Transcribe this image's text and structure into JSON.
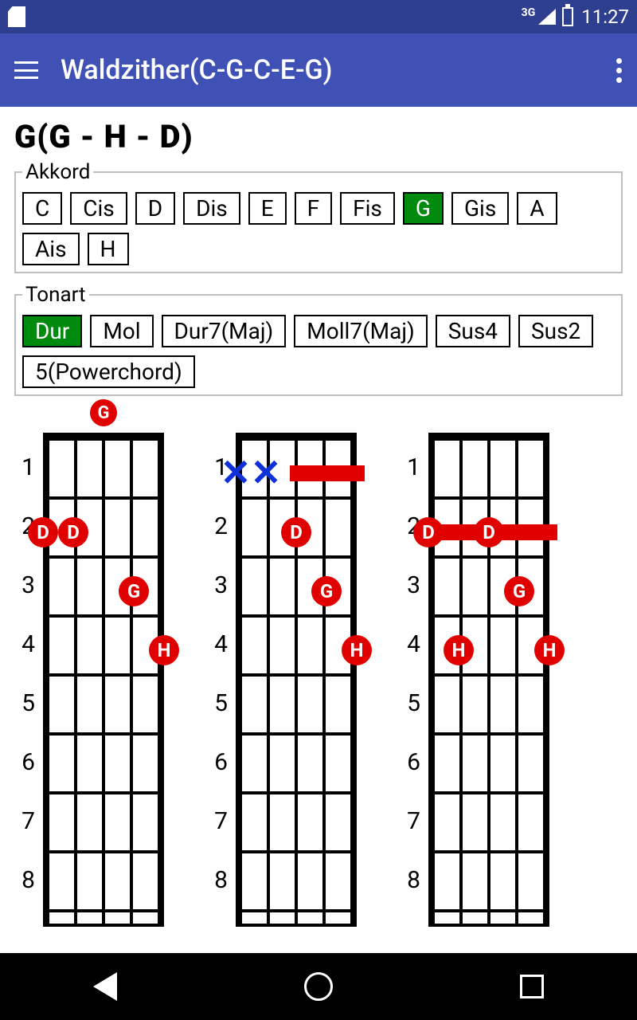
{
  "status": {
    "network": "3G",
    "time": "11:27"
  },
  "appbar": {
    "title": "Waldzither(C-G-C-E-G)"
  },
  "heading": "G(G - H - D)",
  "akkord": {
    "legend": "Akkord",
    "notes": [
      "C",
      "Cis",
      "D",
      "Dis",
      "E",
      "F",
      "Fis",
      "G",
      "Gis",
      "A",
      "Ais",
      "H"
    ],
    "selected": "G"
  },
  "tonart": {
    "legend": "Tonart",
    "modes": [
      "Dur",
      "Mol",
      "Dur7(Maj)",
      "Moll7(Maj)",
      "Sus4",
      "Sus2",
      "5(Powerchord)"
    ],
    "selected": "Dur"
  },
  "fret_labels": [
    "1",
    "2",
    "3",
    "4",
    "5",
    "6",
    "7",
    "8"
  ],
  "chart_data": [
    {
      "type": "fretboard",
      "strings": 5,
      "frets_shown": 8,
      "open": [
        {
          "string": 3,
          "label": "G"
        }
      ],
      "barres": [],
      "mutes": [],
      "dots": [
        {
          "string": 1,
          "fret": 2,
          "label": "D"
        },
        {
          "string": 2,
          "fret": 2,
          "label": "D"
        },
        {
          "string": 4,
          "fret": 3,
          "label": "G"
        },
        {
          "string": 5,
          "fret": 4,
          "label": "H"
        }
      ]
    },
    {
      "type": "fretboard",
      "strings": 5,
      "frets_shown": 8,
      "open": [],
      "barres": [
        {
          "fret": 1,
          "from_string": 3,
          "to_string": 5
        }
      ],
      "mutes": [
        {
          "string": 1,
          "fret": 1
        },
        {
          "string": 2,
          "fret": 1
        }
      ],
      "dots": [
        {
          "string": 3,
          "fret": 2,
          "label": "D"
        },
        {
          "string": 4,
          "fret": 3,
          "label": "G"
        },
        {
          "string": 5,
          "fret": 4,
          "label": "H"
        }
      ]
    },
    {
      "type": "fretboard",
      "strings": 5,
      "frets_shown": 8,
      "open": [],
      "barres": [
        {
          "fret": 2,
          "from_string": 1,
          "to_string": 5
        }
      ],
      "mutes": [],
      "dots": [
        {
          "string": 1,
          "fret": 2,
          "label": "D"
        },
        {
          "string": 3,
          "fret": 2,
          "label": "D"
        },
        {
          "string": 4,
          "fret": 3,
          "label": "G"
        },
        {
          "string": 2,
          "fret": 4,
          "label": "H"
        },
        {
          "string": 5,
          "fret": 4,
          "label": "H"
        }
      ]
    }
  ]
}
